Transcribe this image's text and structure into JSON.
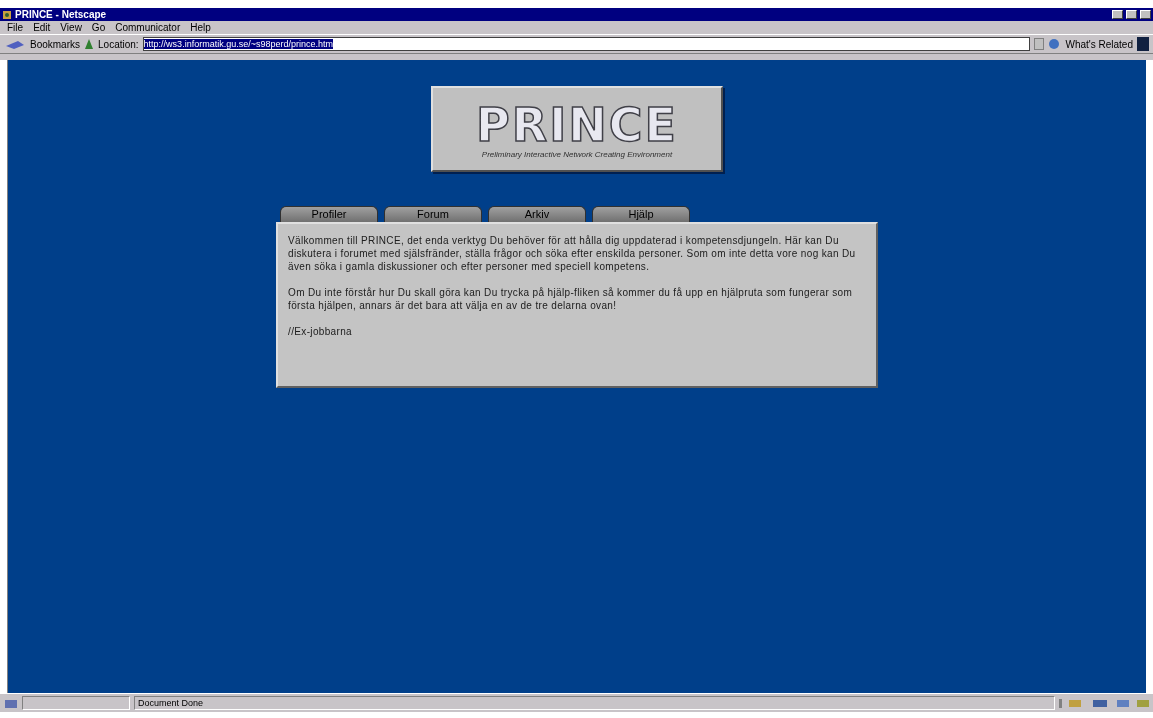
{
  "window": {
    "title": "PRINCE - Netscape"
  },
  "menu": [
    "File",
    "Edit",
    "View",
    "Go",
    "Communicator",
    "Help"
  ],
  "toolbar": {
    "bookmarks": "Bookmarks",
    "location_label": "Location:",
    "url": "http://ws3.informatik.gu.se/~s98perd/prince.htm",
    "related": "What's Related"
  },
  "logo": {
    "title": "PRINCE",
    "subtitle": "Preliminary Interactive Network Creating Environment"
  },
  "tabs": [
    {
      "label": "Profiler"
    },
    {
      "label": "Forum"
    },
    {
      "label": "Arkiv"
    },
    {
      "label": "Hjälp"
    }
  ],
  "content": {
    "paragraphs": [
      "Välkommen till PRINCE, det enda verktyg Du behöver för att hålla dig uppdaterad i kompetensdjungeln. Här kan Du diskutera i forumet med själsfränder, ställa frågor och söka efter enskilda personer. Som om inte detta vore nog kan Du även söka i gamla diskussioner och efter personer med speciell kompetens.",
      "Om Du inte förstår hur Du skall göra kan Du trycka på hjälp-fliken så kommer du få upp en hjälpruta som fungerar som första hjälpen, annars är det bara att välja en av de tre delarna ovan!",
      "//Ex-jobbarna"
    ]
  },
  "status_bar": {
    "text": "Document Done"
  }
}
